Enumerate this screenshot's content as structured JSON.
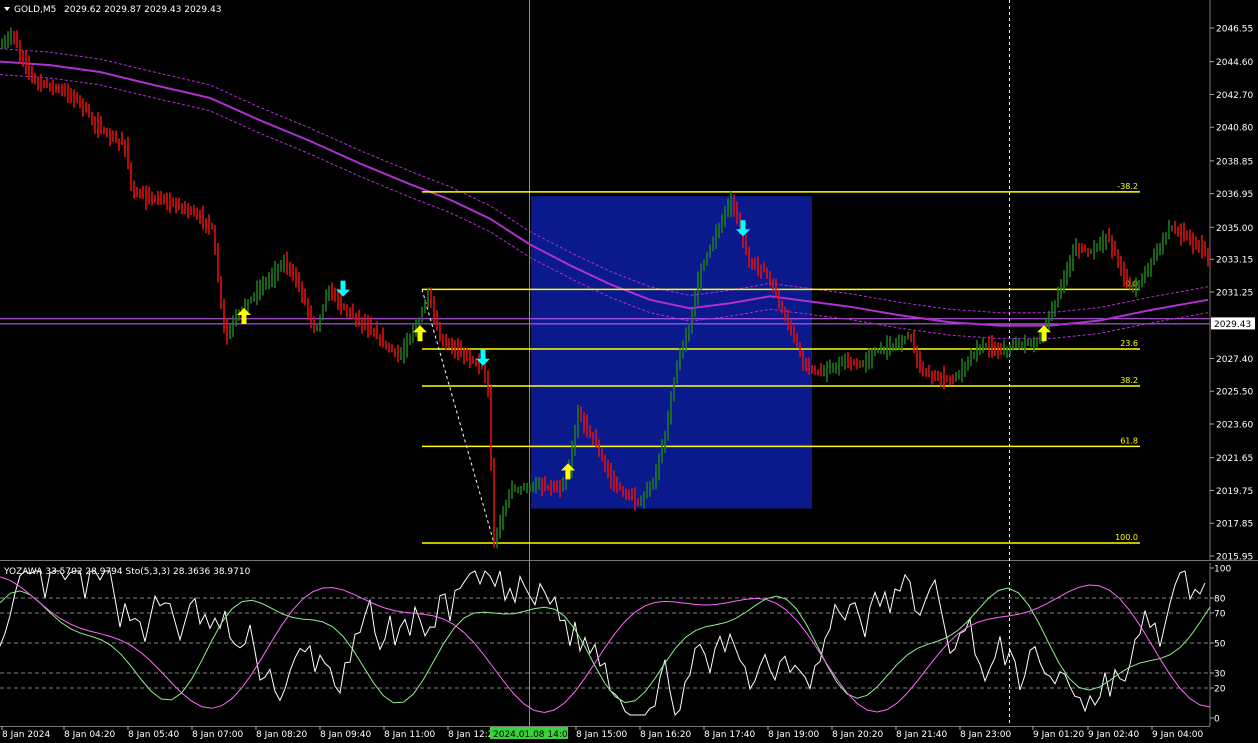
{
  "header": {
    "symbol": "GOLD,M5",
    "ohlc": "2029.62 2029.87 2029.43 2029.43",
    "indicator": "YOZAWA 33.5702 28.9794  Sto(5,3,3) 28.3636 38.9710"
  },
  "colors": {
    "background": "#000000",
    "bull": "#1e7a1e",
    "bear": "#e01010",
    "ma": "#b030d0",
    "fib": "#ffff00",
    "box": "#0a1a8c",
    "arrow_up": "#ffff00",
    "arrow_down": "#00ffff",
    "osc_white": "#ffffff",
    "osc_green": "#90ee90",
    "osc_pink": "#ff66ff",
    "vline": "#33cc33",
    "price_tag": "#ffffff"
  },
  "price_axis": {
    "labels": [
      "2046.55",
      "2044.60",
      "2042.70",
      "2040.80",
      "2038.85",
      "2036.95",
      "2035.00",
      "2033.15",
      "2031.25",
      "2029.43",
      "2027.40",
      "2025.50",
      "2023.60",
      "2021.65",
      "2019.75",
      "2017.85",
      "2015.95"
    ],
    "current": "2029.43"
  },
  "osc_axis": {
    "labels": [
      "100",
      "80",
      "70",
      "50",
      "30",
      "20",
      "0"
    ]
  },
  "time_axis": {
    "labels": [
      "8 Jan 2024",
      "8 Jan 04:20",
      "8 Jan 05:40",
      "8 Jan 07:00",
      "8 Jan 08:20",
      "8 Jan 09:40",
      "8 Jan 11:00",
      "8 Jan 12:20",
      "8 Jan 15:00",
      "8 Jan 16:20",
      "8 Jan 17:40",
      "8 Jan 19:00",
      "8 Jan 20:20",
      "8 Jan 21:40",
      "8 Jan 23:00",
      "9 Jan 01:20",
      "9 Jan 02:40",
      "9 Jan 04:00"
    ],
    "highlight": "2024.01.08 14:00"
  },
  "fibonacci": {
    "levels": [
      {
        "label": "-38.2",
        "price": 2037.05
      },
      {
        "label": "0.0",
        "price": 2031.4
      },
      {
        "label": "23.6",
        "price": 2027.95
      },
      {
        "label": "38.2",
        "price": 2025.8
      },
      {
        "label": "61.8",
        "price": 2022.3
      },
      {
        "label": "100.0",
        "price": 2016.7
      }
    ]
  },
  "chart_data": {
    "type": "candlestick",
    "series": [
      {
        "name": "GOLD,M5"
      }
    ],
    "ylim": [
      2015.5,
      2047.5
    ],
    "keypoints": [
      [
        0,
        2045.5
      ],
      [
        12,
        2046.2
      ],
      [
        22,
        2044.8
      ],
      [
        35,
        2043.5
      ],
      [
        60,
        2043.0
      ],
      [
        80,
        2042.3
      ],
      [
        95,
        2041.0
      ],
      [
        110,
        2040.2
      ],
      [
        125,
        2039.8
      ],
      [
        132,
        2037.0
      ],
      [
        140,
        2036.8
      ],
      [
        160,
        2036.6
      ],
      [
        190,
        2036.0
      ],
      [
        212,
        2035.0
      ],
      [
        220,
        2031.0
      ],
      [
        226,
        2028.5
      ],
      [
        235,
        2029.8
      ],
      [
        260,
        2031.5
      ],
      [
        285,
        2033.0
      ],
      [
        300,
        2031.5
      ],
      [
        315,
        2029.0
      ],
      [
        330,
        2031.5
      ],
      [
        340,
        2030.5
      ],
      [
        360,
        2029.6
      ],
      [
        385,
        2028.2
      ],
      [
        400,
        2027.5
      ],
      [
        420,
        2029.8
      ],
      [
        428,
        2031.2
      ],
      [
        440,
        2028.5
      ],
      [
        460,
        2027.8
      ],
      [
        482,
        2027.0
      ],
      [
        488,
        2025.5
      ],
      [
        494,
        2016.7
      ],
      [
        510,
        2019.8
      ],
      [
        540,
        2020.0
      ],
      [
        560,
        2019.8
      ],
      [
        570,
        2021.2
      ],
      [
        578,
        2024.3
      ],
      [
        595,
        2022.5
      ],
      [
        610,
        2020.5
      ],
      [
        625,
        2019.5
      ],
      [
        640,
        2019.0
      ],
      [
        655,
        2020.5
      ],
      [
        665,
        2023.0
      ],
      [
        675,
        2026.5
      ],
      [
        690,
        2029.5
      ],
      [
        700,
        2032.5
      ],
      [
        715,
        2034.5
      ],
      [
        730,
        2036.6
      ],
      [
        738,
        2035.5
      ],
      [
        748,
        2033.0
      ],
      [
        765,
        2032.5
      ],
      [
        780,
        2030.5
      ],
      [
        795,
        2028.5
      ],
      [
        805,
        2027.0
      ],
      [
        820,
        2026.5
      ],
      [
        845,
        2027.2
      ],
      [
        860,
        2027.0
      ],
      [
        875,
        2027.8
      ],
      [
        895,
        2028.2
      ],
      [
        910,
        2028.8
      ],
      [
        922,
        2026.5
      ],
      [
        940,
        2026.3
      ],
      [
        955,
        2026.2
      ],
      [
        970,
        2027.5
      ],
      [
        985,
        2028.2
      ],
      [
        1000,
        2027.8
      ],
      [
        1020,
        2028.2
      ],
      [
        1040,
        2028.5
      ],
      [
        1050,
        2029.8
      ],
      [
        1060,
        2031.5
      ],
      [
        1075,
        2033.8
      ],
      [
        1090,
        2033.6
      ],
      [
        1108,
        2034.5
      ],
      [
        1118,
        2033.0
      ],
      [
        1130,
        2031.5
      ],
      [
        1140,
        2031.8
      ],
      [
        1155,
        2033.5
      ],
      [
        1170,
        2035.0
      ],
      [
        1185,
        2034.5
      ],
      [
        1200,
        2033.8
      ],
      [
        1208,
        2033.3
      ]
    ],
    "arrows": [
      {
        "x": 244,
        "dir": "up",
        "price": 2029.8
      },
      {
        "x": 343,
        "dir": "down",
        "price": 2031.5
      },
      {
        "x": 420,
        "dir": "up",
        "price": 2028.8
      },
      {
        "x": 483,
        "dir": "down",
        "price": 2027.5
      },
      {
        "x": 568,
        "dir": "up",
        "price": 2020.8
      },
      {
        "x": 743,
        "dir": "down",
        "price": 2035.0
      },
      {
        "x": 1044,
        "dir": "up",
        "price": 2028.8
      }
    ],
    "ma_keypoints": [
      [
        0,
        2044.6
      ],
      [
        50,
        2044.4
      ],
      [
        100,
        2044.0
      ],
      [
        150,
        2043.3
      ],
      [
        210,
        2042.5
      ],
      [
        260,
        2041.2
      ],
      [
        310,
        2040.0
      ],
      [
        360,
        2038.7
      ],
      [
        410,
        2037.5
      ],
      [
        450,
        2036.6
      ],
      [
        490,
        2035.5
      ],
      [
        530,
        2034.0
      ],
      [
        570,
        2032.8
      ],
      [
        610,
        2031.7
      ],
      [
        650,
        2030.8
      ],
      [
        690,
        2030.3
      ],
      [
        730,
        2030.6
      ],
      [
        770,
        2031.0
      ],
      [
        810,
        2030.7
      ],
      [
        850,
        2030.4
      ],
      [
        900,
        2029.9
      ],
      [
        950,
        2029.5
      ],
      [
        1000,
        2029.3
      ],
      [
        1050,
        2029.3
      ],
      [
        1100,
        2029.6
      ],
      [
        1150,
        2030.2
      ],
      [
        1208,
        2030.8
      ]
    ],
    "fib_x": [
      422,
      1140
    ],
    "box": {
      "x1": 531,
      "x2": 812,
      "p1": 2036.8,
      "p2": 2018.7
    },
    "osc_ylim": [
      0,
      100
    ]
  }
}
